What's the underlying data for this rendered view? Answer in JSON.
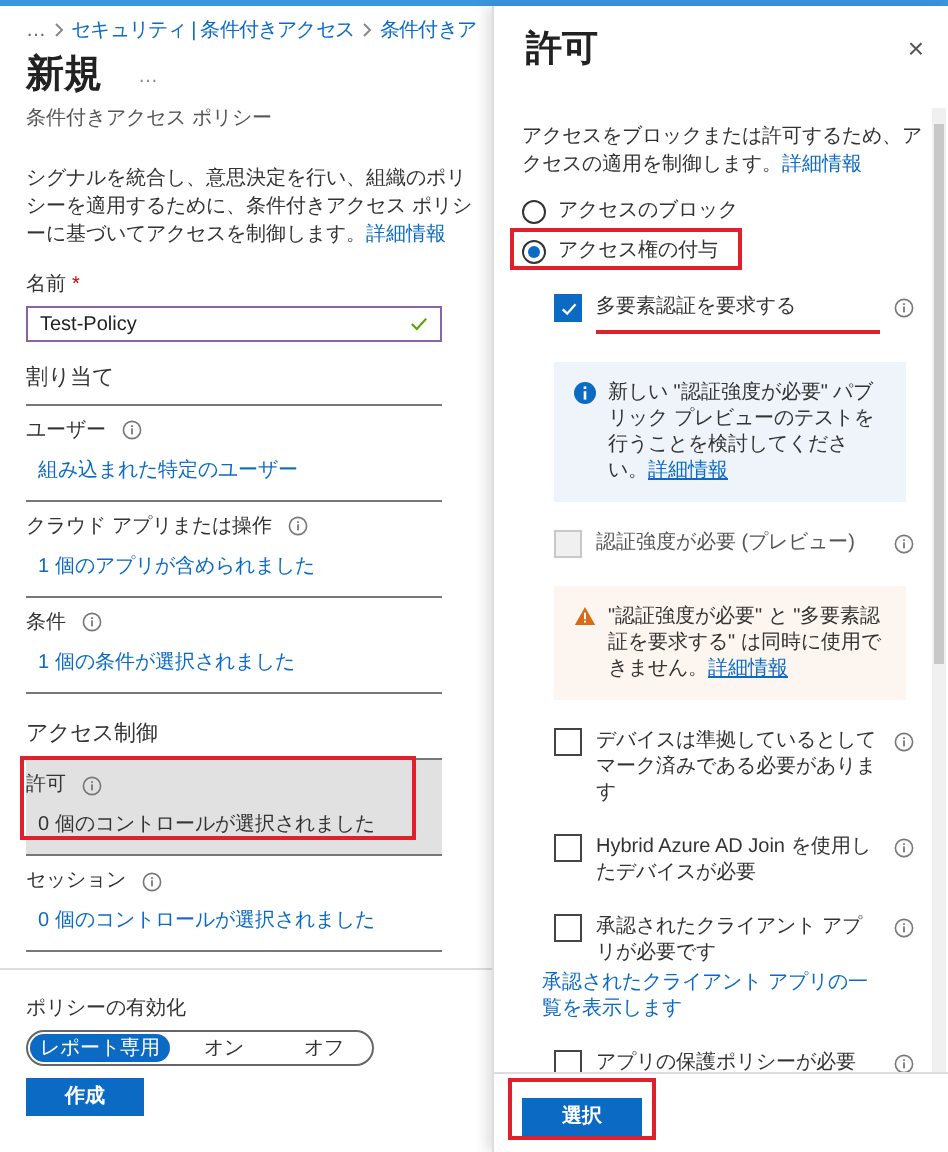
{
  "breadcrumb": {
    "more": "…",
    "items": [
      "セキュリティ | 条件付きアクセス",
      "条件付きア"
    ]
  },
  "page": {
    "title": "新規",
    "more": "…",
    "subtitle": "条件付きアクセス ポリシー",
    "description": "シグナルを統合し、意思決定を行い、組織のポリシーを適用するために、条件付きアクセス ポリシーに基づいてアクセスを制御します。",
    "description_link": "詳細情報"
  },
  "name_field": {
    "label": "名前",
    "required": "*",
    "value": "Test-Policy",
    "valid": true
  },
  "assignments": {
    "heading": "割り当て",
    "items": [
      {
        "label": "ユーザー",
        "value": "組み込まれた特定のユーザー"
      },
      {
        "label": "クラウド アプリまたは操作",
        "value": "1 個のアプリが含められました"
      },
      {
        "label": "条件",
        "value": "1 個の条件が選択されました"
      }
    ]
  },
  "access_controls": {
    "heading": "アクセス制御",
    "items": [
      {
        "label": "許可",
        "value": "0 個のコントロールが選択されました",
        "selected": true,
        "highlighted": true
      },
      {
        "label": "セッション",
        "value": "0 個のコントロールが選択されました",
        "selected": false,
        "highlighted": false
      }
    ]
  },
  "enable_policy": {
    "label": "ポリシーの有効化",
    "options": [
      {
        "label": "レポート専用",
        "selected": true
      },
      {
        "label": "オン",
        "selected": false
      },
      {
        "label": "オフ",
        "selected": false
      }
    ]
  },
  "create_button": "作成",
  "grant_panel": {
    "title": "許可",
    "close": "×",
    "description": "アクセスをブロックまたは許可するため、アクセスの適用を制御します。",
    "description_link": "詳細情報",
    "radios": [
      {
        "label": "アクセスのブロック",
        "selected": false,
        "highlighted": false
      },
      {
        "label": "アクセス権の付与",
        "selected": true,
        "highlighted": true
      }
    ],
    "controls": [
      {
        "kind": "checkbox",
        "label": "多要素認証を要求する",
        "checked": true,
        "disabled": false,
        "highlighted": true
      },
      {
        "kind": "info",
        "text": "新しい \"認証強度が必要\" パブリック プレビューのテストを行うことを検討してください。",
        "link": "詳細情報"
      },
      {
        "kind": "checkbox",
        "label": "認証強度が必要 (プレビュー)",
        "checked": false,
        "disabled": true,
        "highlighted": false
      },
      {
        "kind": "warning",
        "text": "\"認証強度が必要\" と \"多要素認証を要求する\" は同時に使用できません。",
        "link": "詳細情報"
      },
      {
        "kind": "checkbox",
        "label": "デバイスは準拠しているとしてマーク済みである必要があります",
        "checked": false,
        "disabled": false,
        "highlighted": false
      },
      {
        "kind": "checkbox",
        "label": "Hybrid Azure AD Join を使用したデバイスが必要",
        "checked": false,
        "disabled": false,
        "highlighted": false
      },
      {
        "kind": "checkbox",
        "label": "承認されたクライアント アプリが必要です",
        "checked": false,
        "disabled": false,
        "highlighted": false,
        "link": "承認されたクライアント アプリの一覧を表示します"
      },
      {
        "kind": "checkbox",
        "label": "アプリの保護ポリシーが必要",
        "checked": false,
        "disabled": false,
        "highlighted": false
      }
    ],
    "select_button": {
      "label": "選択",
      "highlighted": true
    }
  }
}
